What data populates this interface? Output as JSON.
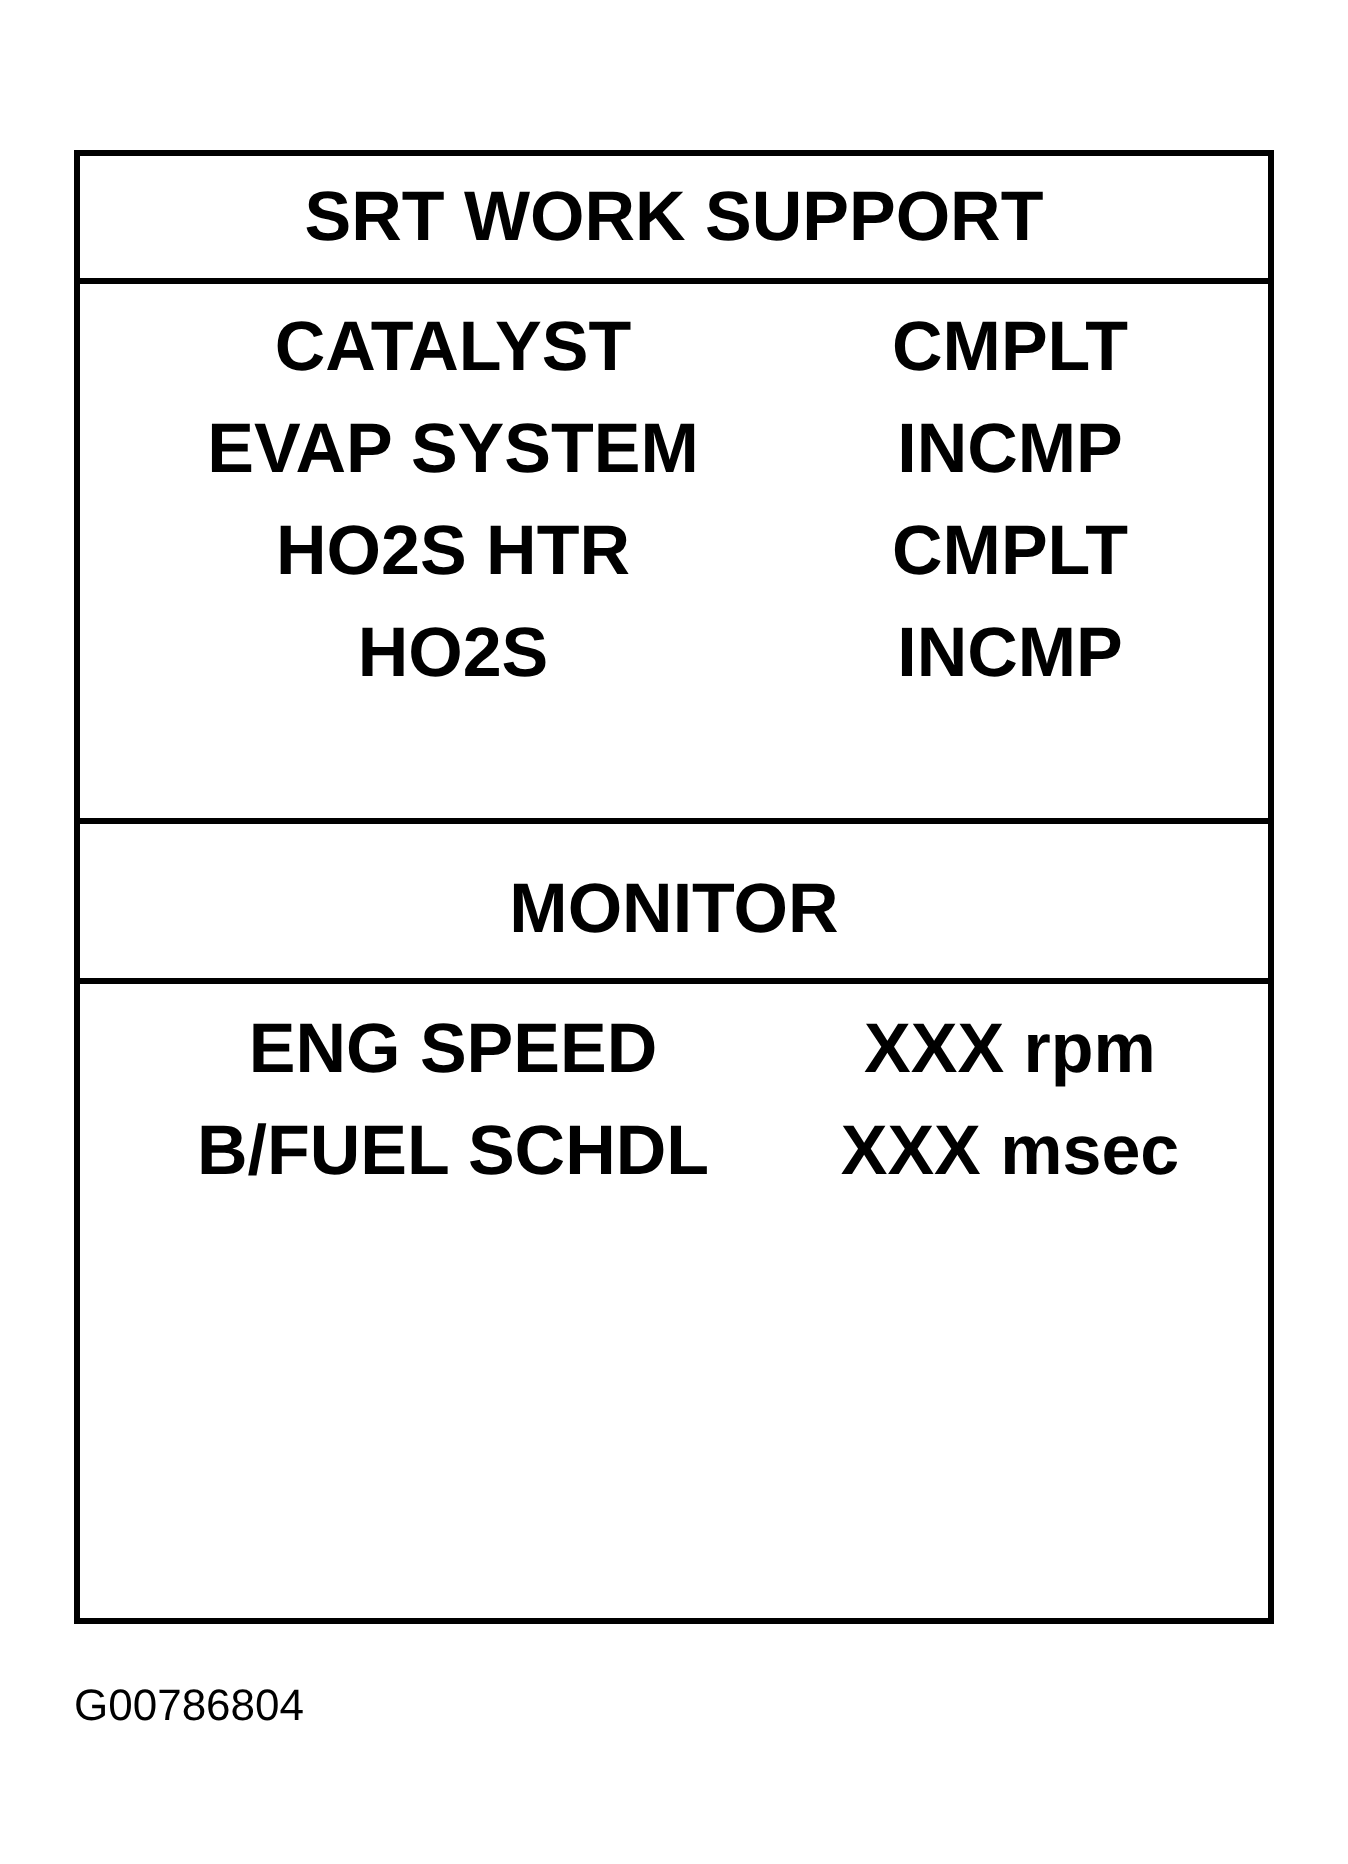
{
  "title": "SRT WORK SUPPORT",
  "items": [
    {
      "label": "CATALYST",
      "status": "CMPLT"
    },
    {
      "label": "EVAP SYSTEM",
      "status": "INCMP"
    },
    {
      "label": "HO2S HTR",
      "status": "CMPLT"
    },
    {
      "label": "HO2S",
      "status": "INCMP"
    }
  ],
  "monitor": {
    "title": "MONITOR",
    "items": [
      {
        "label": "ENG SPEED",
        "value": "XXX rpm"
      },
      {
        "label": "B/FUEL SCHDL",
        "value": "XXX msec"
      }
    ]
  },
  "caption": "G00786804"
}
